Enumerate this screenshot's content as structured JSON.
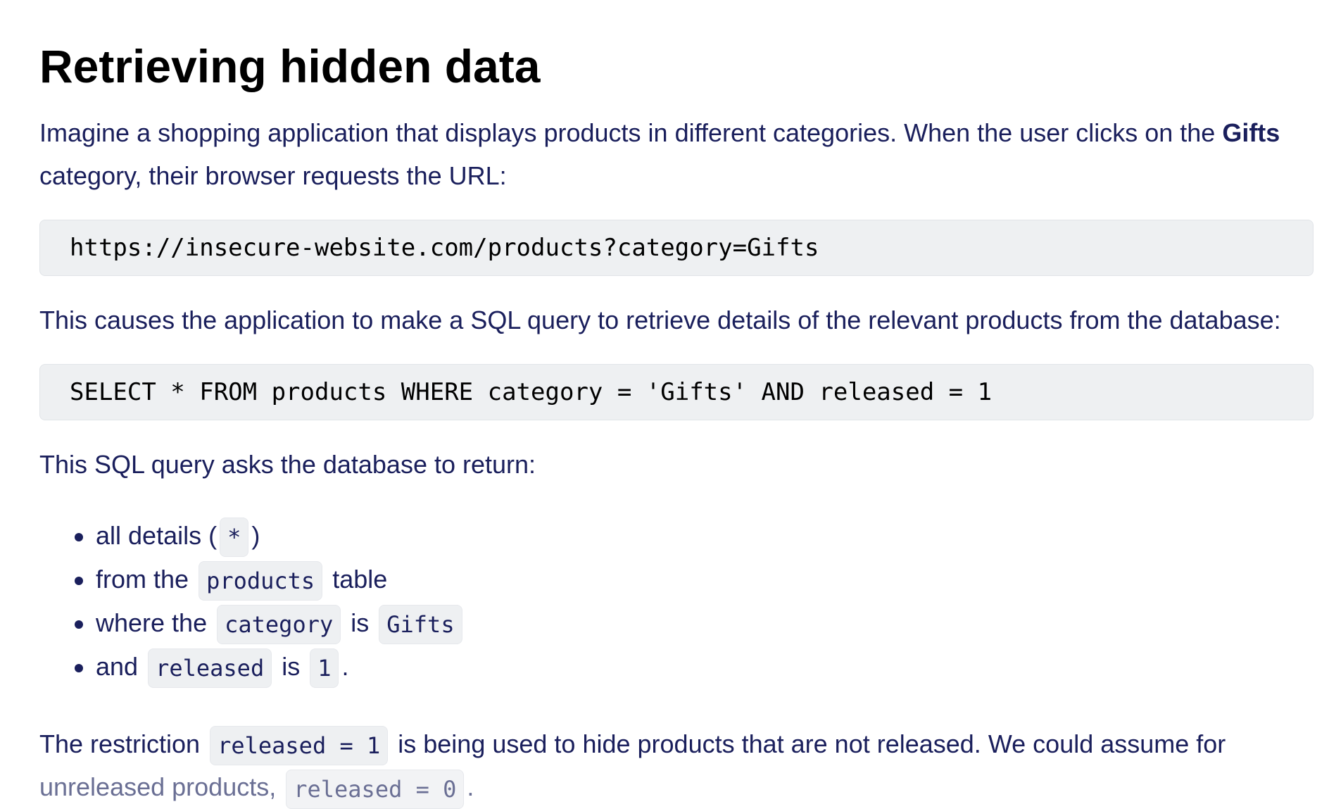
{
  "heading": "Retrieving hidden data",
  "intro": {
    "part1": "Imagine a shopping application that displays products in different categories. When the user clicks on the ",
    "bold": "Gifts",
    "part2": " category, their browser requests the URL:"
  },
  "url_code": "https://insecure-website.com/products?category=Gifts",
  "causes_text": "This causes the application to make a SQL query to retrieve details of the relevant products from the database:",
  "sql_code": "SELECT * FROM products WHERE category = 'Gifts' AND released = 1",
  "asks_text": "This SQL query asks the database to return:",
  "list": {
    "item1": {
      "pre": "all details (",
      "code": "*",
      "post": ")"
    },
    "item2": {
      "pre": "from the ",
      "code": "products",
      "post": " table"
    },
    "item3": {
      "pre": "where the ",
      "code1": "category",
      "mid": " is ",
      "code2": "Gifts"
    },
    "item4": {
      "pre": "and ",
      "code1": "released",
      "mid": " is ",
      "code2": "1",
      "post": "."
    }
  },
  "restriction": {
    "pre": "The restriction ",
    "code": "released = 1",
    "post": " is being used to hide products that are not released. We could assume for",
    "line2_pre": "unreleased products, ",
    "line2_code": "released = 0",
    "line2_post": "."
  }
}
